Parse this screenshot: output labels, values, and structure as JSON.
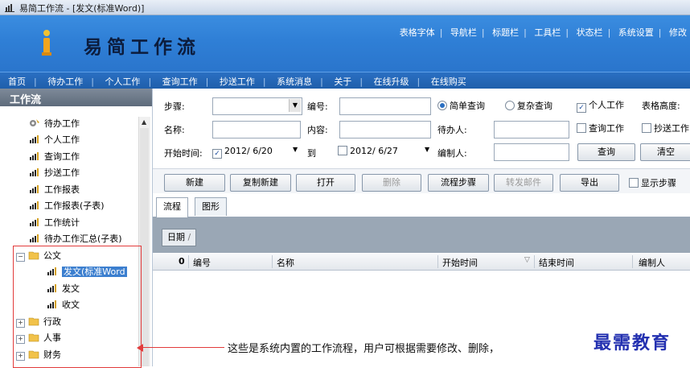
{
  "window": {
    "title": "易简工作流 - [发文(标准Word)]"
  },
  "banner": {
    "app_name": "易简工作流",
    "links": [
      "表格字体",
      "导航栏",
      "标题栏",
      "工具栏",
      "状态栏",
      "系统设置",
      "修改"
    ]
  },
  "nav": {
    "items": [
      "首页",
      "待办工作",
      "个人工作",
      "查询工作",
      "抄送工作",
      "系统消息",
      "关于",
      "在线升级",
      "在线购买"
    ]
  },
  "sidebar": {
    "title": "工作流",
    "items": [
      {
        "label": "待办工作",
        "icon": "gear-icon"
      },
      {
        "label": "个人工作",
        "icon": "chart-icon"
      },
      {
        "label": "查询工作",
        "icon": "chart-icon"
      },
      {
        "label": "抄送工作",
        "icon": "chart-icon"
      },
      {
        "label": "工作报表",
        "icon": "chart-icon"
      },
      {
        "label": "工作报表(子表)",
        "icon": "chart-icon"
      },
      {
        "label": "工作统计",
        "icon": "chart-icon"
      },
      {
        "label": "待办工作汇总(子表)",
        "icon": "chart-icon"
      }
    ],
    "folder_open": "公文",
    "subitems": [
      "发文(标准Word",
      "发文",
      "收文"
    ],
    "folders": [
      "行政",
      "人事",
      "财务"
    ]
  },
  "filter": {
    "step_label": "步骤:",
    "number_label": "编号:",
    "simple_query": "简单查询",
    "complex_query": "复杂查询",
    "personal_work": "个人工作",
    "table_height": "表格高度:",
    "name_label": "名称:",
    "content_label": "内容:",
    "pending_label": "待办人:",
    "query_work": "查询工作",
    "cc_work": "抄送工作",
    "start_time_label": "开始时间:",
    "start_date": "2012/ 6/20",
    "to_label": "到",
    "end_date": "2012/ 6/27",
    "editor_label": "编制人:",
    "query_btn": "查询",
    "clear_btn": "清空"
  },
  "toolbar": {
    "new": "新建",
    "copy_new": "复制新建",
    "open": "打开",
    "delete": "删除",
    "flow_steps": "流程步骤",
    "forward_mail": "转发邮件",
    "export": "导出",
    "show_steps": "显示步骤"
  },
  "tabs": [
    "流程",
    "图形"
  ],
  "group_by": "日期",
  "grid": {
    "columns": [
      "0",
      "编号",
      "名称",
      "开始时间",
      "结束时间",
      "编制人"
    ]
  },
  "annotation": "这些是系统内置的工作流程，用户可根据需要修改、删除，",
  "watermark": "最需教育",
  "colors": {
    "banner": "#2f7fd6",
    "nav": "#1f5fab",
    "selected": "#3c7fcf",
    "annotation": "#e23b3b"
  }
}
